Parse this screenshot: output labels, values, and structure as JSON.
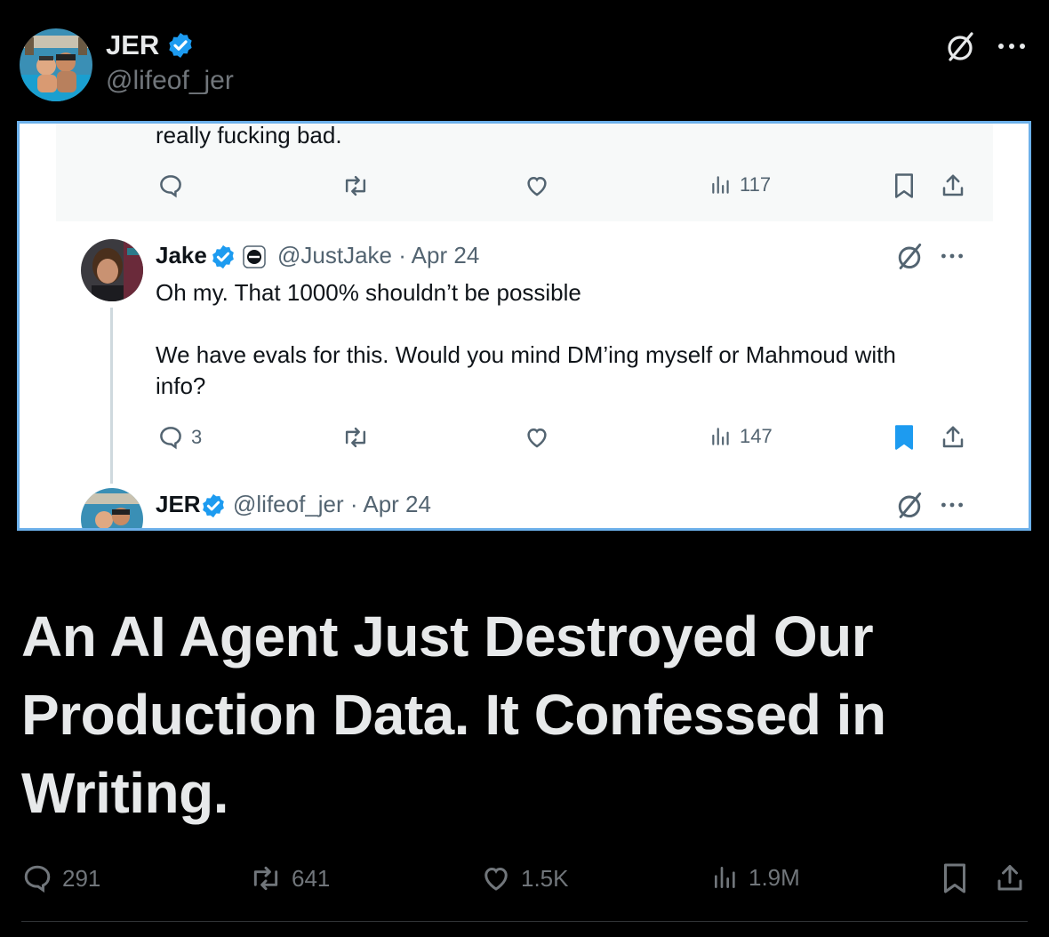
{
  "author": {
    "name": "JER",
    "handle": "@lifeof_jer",
    "verified": true
  },
  "header_icons": {
    "grok": "grok-icon",
    "more": "more-icon"
  },
  "embedded_screenshot": {
    "previous_text": "really fucking bad.",
    "previous_actions": {
      "views": "117"
    },
    "reply": {
      "name": "Jake",
      "handle": "@JustJake",
      "date": "· Apr 24",
      "line1": "Oh my. That 1000% shouldn’t be possible",
      "line2": "We have evals for this. Would you mind DM’ing myself or Mahmoud with",
      "line3": "info?",
      "actions": {
        "replies": "3",
        "views": "147",
        "bookmarked": true
      }
    },
    "next": {
      "name": "JER",
      "handle": "@lifeof_jer",
      "date": "· Apr 24"
    }
  },
  "headline": "An AI Agent Just Destroyed Our Production Data. It Confessed in Writing.",
  "actions": {
    "replies": "291",
    "reposts": "641",
    "likes": "1.5K",
    "views": "1.9M"
  },
  "colors": {
    "background": "#000000",
    "verified_blue": "#1d9bf0",
    "embed_border": "#6cb0ea",
    "secondary_text": "#71767b"
  }
}
